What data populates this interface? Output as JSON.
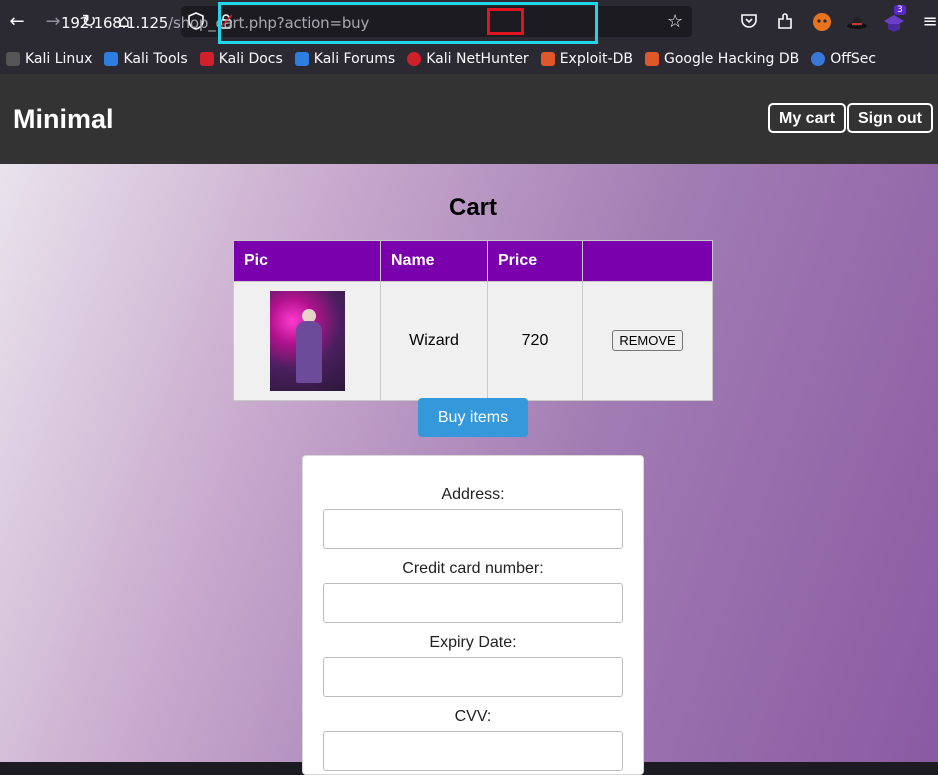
{
  "browser": {
    "url_host": "192.168.1.125",
    "url_path": "/shop_cart.php?action=buy",
    "notification_count": "3"
  },
  "bookmarks": [
    {
      "label": "Kali Linux",
      "color": "#e8e8e8"
    },
    {
      "label": "Kali Tools",
      "color": "#2e7de0"
    },
    {
      "label": "Kali Docs",
      "color": "#d0202a"
    },
    {
      "label": "Kali Forums",
      "color": "#2e7de0"
    },
    {
      "label": "Kali NetHunter",
      "color": "#d0202a"
    },
    {
      "label": "Exploit-DB",
      "color": "#e0582a"
    },
    {
      "label": "Google Hacking DB",
      "color": "#e0582a"
    },
    {
      "label": "OffSec",
      "color": "#3a78d8"
    }
  ],
  "header": {
    "brand": "Minimal",
    "my_cart": "My cart",
    "sign_out": "Sign out"
  },
  "cart": {
    "title": "Cart",
    "columns": [
      "Pic",
      "Name",
      "Price",
      ""
    ],
    "rows": [
      {
        "name": "Wizard",
        "price": "720",
        "action": "REMOVE"
      }
    ],
    "buy_label": "Buy items"
  },
  "form": {
    "address_label": "Address:",
    "card_label": "Credit card number:",
    "expiry_label": "Expiry Date:",
    "cvv_label": "CVV:"
  },
  "colors": {
    "header_bg": "#333333",
    "table_header": "#7a00ad",
    "buy_button": "#3498db",
    "highlight_cyan": "#1fd6e6",
    "highlight_red": "#e0141e"
  }
}
